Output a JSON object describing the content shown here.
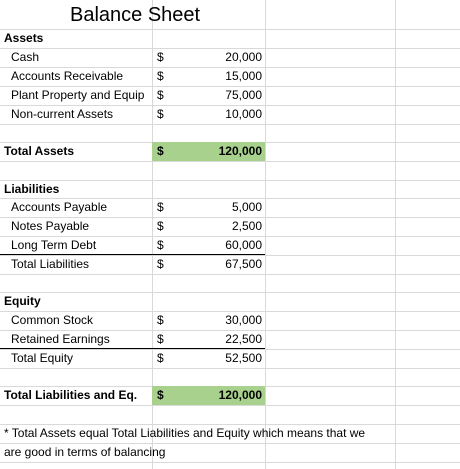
{
  "title": "Balance Sheet",
  "currency_symbol": "$",
  "highlight_color": "#a9d18e",
  "assets": {
    "heading": "Assets",
    "items": [
      {
        "label": "Cash",
        "value": "20,000"
      },
      {
        "label": "Accounts Receivable",
        "value": "15,000"
      },
      {
        "label": "Plant Property and Equip",
        "value": "75,000"
      },
      {
        "label": "Non-current Assets",
        "value": "10,000"
      }
    ],
    "total_label": "Total Assets",
    "total_value": "120,000"
  },
  "liabilities": {
    "heading": "Liabilities",
    "items": [
      {
        "label": "Accounts Payable",
        "value": "5,000"
      },
      {
        "label": "Notes Payable",
        "value": "2,500"
      },
      {
        "label": "Long Term Debt",
        "value": "60,000"
      },
      {
        "label": "Total Liabilities",
        "value": "67,500"
      }
    ]
  },
  "equity": {
    "heading": "Equity",
    "items": [
      {
        "label": "Common Stock",
        "value": "30,000"
      },
      {
        "label": "Retained Earnings",
        "value": "22,500"
      },
      {
        "label": "Total Equity",
        "value": "52,500"
      }
    ]
  },
  "grand_total": {
    "label": "Total Liabilities and Eq.",
    "value": "120,000"
  },
  "note": {
    "line1": "* Total Assets equal Total Liabilities and Equity which means that we",
    "line2": "are good in terms of balancing"
  }
}
